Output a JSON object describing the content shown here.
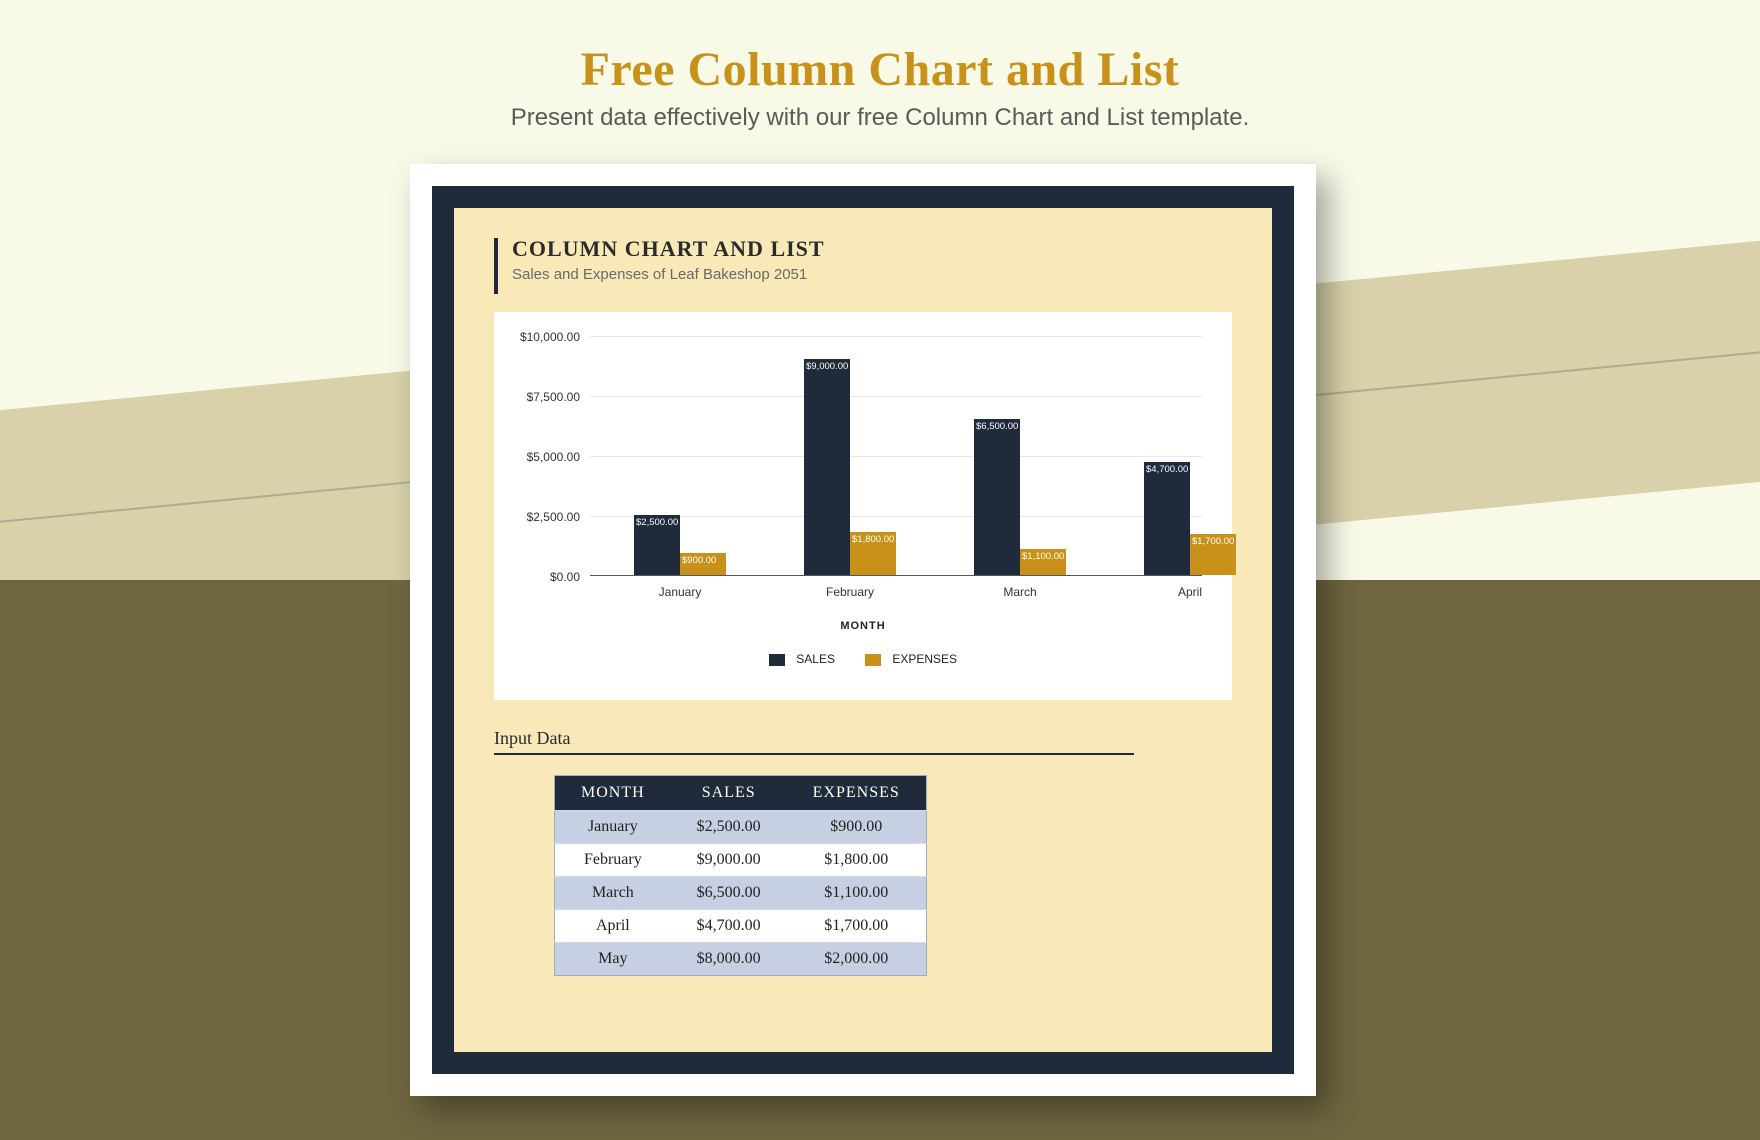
{
  "page": {
    "title": "Free Column Chart and List",
    "subtitle": "Present data effectively with our free Column Chart and List template."
  },
  "doc": {
    "title": "COLUMN CHART AND LIST",
    "subtitle": "Sales and Expenses of Leaf Bakeshop 2051"
  },
  "chart_data": {
    "type": "bar",
    "title": "",
    "xlabel": "MONTH",
    "ylabel": "",
    "ylim": [
      0,
      10000
    ],
    "yticks": [
      "$0.00",
      "$2,500.00",
      "$5,000.00",
      "$7,500.00",
      "$10,000.00"
    ],
    "categories": [
      "January",
      "February",
      "March",
      "April"
    ],
    "series": [
      {
        "name": "SALES",
        "values": [
          2500,
          9000,
          6500,
          4700
        ],
        "labels": [
          "$2,500.00",
          "$9,000.00",
          "$6,500.00",
          "$4,700.00"
        ],
        "color": "#1f2a3a"
      },
      {
        "name": "EXPENSES",
        "values": [
          900,
          1800,
          1100,
          1700
        ],
        "labels": [
          "$900.00",
          "$1,800.00",
          "$1,100.00",
          "$1,700.00"
        ],
        "color": "#c8921a"
      }
    ]
  },
  "table": {
    "heading": "Input Data",
    "columns": [
      "MONTH",
      "SALES",
      "EXPENSES"
    ],
    "rows": [
      {
        "month": "January",
        "sales": "$2,500.00",
        "expenses": "$900.00"
      },
      {
        "month": "February",
        "sales": "$9,000.00",
        "expenses": "$1,800.00"
      },
      {
        "month": "March",
        "sales": "$6,500.00",
        "expenses": "$1,100.00"
      },
      {
        "month": "April",
        "sales": "$4,700.00",
        "expenses": "$1,700.00"
      },
      {
        "month": "May",
        "sales": "$8,000.00",
        "expenses": "$2,000.00"
      }
    ]
  }
}
